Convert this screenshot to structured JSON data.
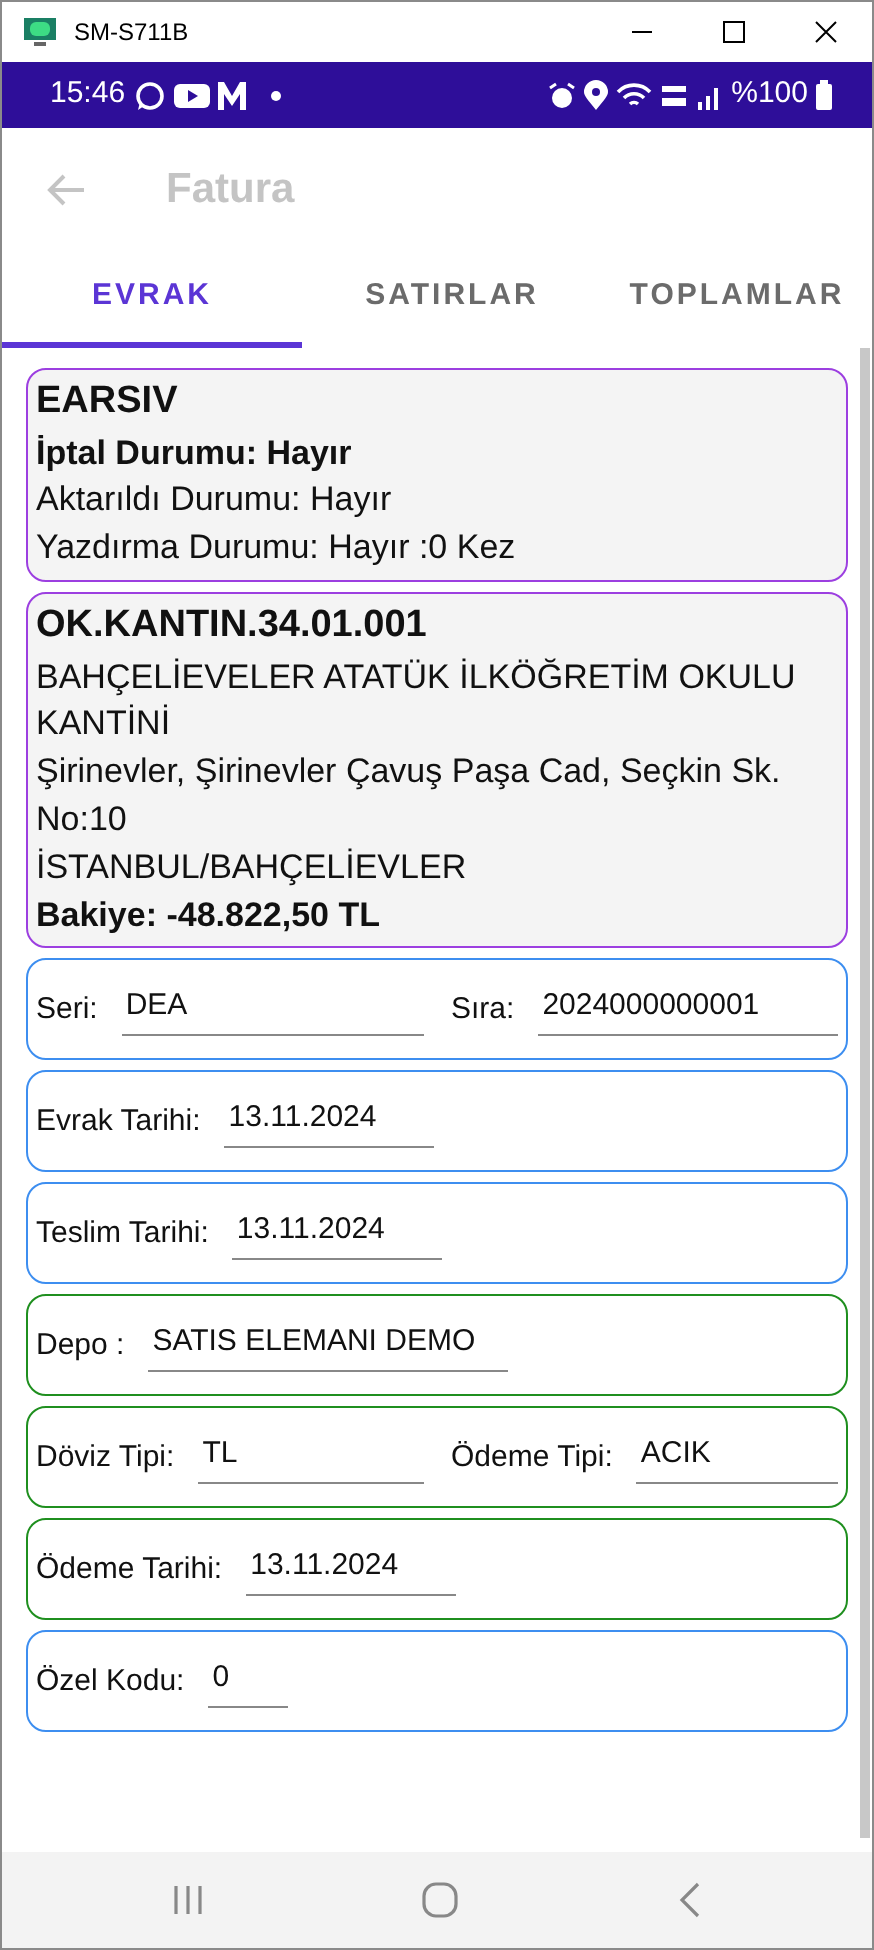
{
  "window": {
    "title": "SM-S711B"
  },
  "status_bar": {
    "time": "15:46",
    "battery": "%100"
  },
  "app_bar": {
    "title": "Fatura"
  },
  "tabs": [
    {
      "label": "EVRAK",
      "selected": true
    },
    {
      "label": "SATIRLAR",
      "selected": false
    },
    {
      "label": "TOPLAMLAR",
      "selected": false
    }
  ],
  "document_card": {
    "color": "#9c3fe0",
    "lines": [
      {
        "text": "EARSIV",
        "bold": true
      },
      {
        "text": "İptal Durumu: Hayır",
        "bold": true
      },
      {
        "text": "Aktarıldı Durumu: Hayır",
        "bold": false
      },
      {
        "text": "Yazdırma Durumu: Hayır :0 Kez",
        "bold": false
      }
    ]
  },
  "customer_card": {
    "color": "#9c3fe0",
    "lines": [
      {
        "text": "OK.KANTIN.34.01.001",
        "bold": true
      },
      {
        "text": "BAHÇELİEVELER ATATÜK İLKÖĞRETİM OKULU KANTİNİ",
        "bold": false
      },
      {
        "text": "Şirinevler, Şirinevler Çavuş Paşa Cad, Seçkin Sk. No:10",
        "bold": false
      },
      {
        "text": "İSTANBUL/BAHÇELİEVLER",
        "bold": false
      },
      {
        "text": "Bakiye: -48.822,50 TL",
        "bold": true
      }
    ]
  },
  "form_cards": [
    {
      "color": "#3d8ef0",
      "fields": [
        {
          "label": "Seri:",
          "value": "DEA"
        },
        {
          "label": "Sıra:",
          "value": "2024000000001"
        }
      ]
    },
    {
      "color": "#3d8ef0",
      "fields": [
        {
          "label": "Evrak Tarihi:",
          "value": "13.11.2024"
        }
      ]
    },
    {
      "color": "#3d8ef0",
      "fields": [
        {
          "label": "Teslim Tarihi:",
          "value": "13.11.2024"
        }
      ]
    },
    {
      "color": "#1f8f1f",
      "fields": [
        {
          "label": "Depo :",
          "value": "SATIS ELEMANI DEMO"
        }
      ]
    },
    {
      "color": "#1f8f1f",
      "fields": [
        {
          "label": "Döviz Tipi:",
          "value": "TL"
        },
        {
          "label": "Ödeme Tipi:",
          "value": "ACIK"
        }
      ]
    },
    {
      "color": "#1f8f1f",
      "fields": [
        {
          "label": "Ödeme Tarihi:",
          "value": "13.11.2024"
        }
      ]
    },
    {
      "color": "#3d8ef0",
      "fields": [
        {
          "label": "Özel Kodu:",
          "value": "0"
        }
      ]
    }
  ]
}
